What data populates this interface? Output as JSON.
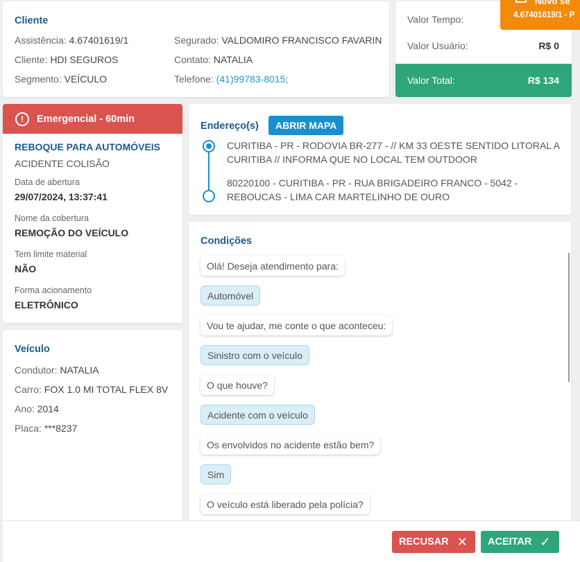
{
  "cliente": {
    "title": "Cliente",
    "assistencia_label": "Assistência:",
    "assistencia_value": "4.67401619/1",
    "cliente_label": "Cliente:",
    "cliente_value": "HDI SEGUROS",
    "segmento_label": "Segmento:",
    "segmento_value": "VEÍCULO",
    "segurado_label": "Segurado:",
    "segurado_value": "VALDOMIRO FRANCISCO FAVARIN",
    "contato_label": "Contato:",
    "contato_value": "NATALIA",
    "telefone_label": "Telefone:",
    "telefone_value": "(41)99783-8015;"
  },
  "valores": {
    "tempo_label": "Valor Tempo:",
    "usuario_label": "Valor Usuário:",
    "usuario_value": "R$ 0",
    "total_label": "Valor Total:",
    "total_value": "R$ 134",
    "total_color": "#2fa67a"
  },
  "novo_badge": {
    "title": "Novo se",
    "subtitle": "4.67401619/1 - P",
    "color": "#f28a0b"
  },
  "servico": {
    "emergency_label": "Emergencial - 60min",
    "emergency_color": "#d9534f",
    "service_name": "REBOQUE PARA AUTOMÓVEIS",
    "cause": "ACIDENTE COLISÃO",
    "abertura_label": "Data de abertura",
    "abertura_value": "29/07/2024, 13:37:41",
    "cobertura_label": "Nome da cobertura",
    "cobertura_value": "REMOÇÃO DO VEÍCULO",
    "limite_label": "Tem limite material",
    "limite_value": "NÃO",
    "forma_label": "Forma acionamento",
    "forma_value": "ELETRÔNICO"
  },
  "veiculo": {
    "title": "Veículo",
    "condutor_label": "Condutor:",
    "condutor_value": "NATALIA",
    "carro_label": "Carro:",
    "carro_value": "FOX 1.0 MI TOTAL FLEX 8V",
    "ano_label": "Ano:",
    "ano_value": "2014",
    "placa_label": "Placa:",
    "placa_value": "***8237"
  },
  "endereco": {
    "title": "Endereço(s)",
    "map_button": "ABRIR MAPA",
    "addresses": [
      "CURITIBA - PR - RODOVIA BR-277 - // KM 33 OESTE SENTIDO LITORAL A CURITIBA // INFORMA QUE NO LOCAL TEM OUTDOOR",
      "80220100 - CURITIBA - PR - RUA BRIGADEIRO FRANCO - 5042 - REBOUCAS - LIMA CAR MARTELINHO DE OURO"
    ]
  },
  "condicoes": {
    "title": "Condições",
    "messages": [
      {
        "text": "Olá! Deseja atendimento para:",
        "from": "bot"
      },
      {
        "text": "Automóvel",
        "from": "user"
      },
      {
        "text": "Vou te ajudar, me conte o que aconteceu:",
        "from": "bot"
      },
      {
        "text": "Sinistro com o veículo",
        "from": "user"
      },
      {
        "text": "O que houve?",
        "from": "bot"
      },
      {
        "text": "Acidente com o veículo",
        "from": "user"
      },
      {
        "text": "Os envolvidos no acidente estão bem?",
        "from": "bot"
      },
      {
        "text": "Sim",
        "from": "user"
      },
      {
        "text": "O veículo está liberado pela polícia?",
        "from": "bot"
      }
    ]
  },
  "footer": {
    "recusar_label": "RECUSAR",
    "aceitar_label": "ACEITAR",
    "recusar_icon": "close-icon",
    "aceitar_icon": "check-icon"
  }
}
